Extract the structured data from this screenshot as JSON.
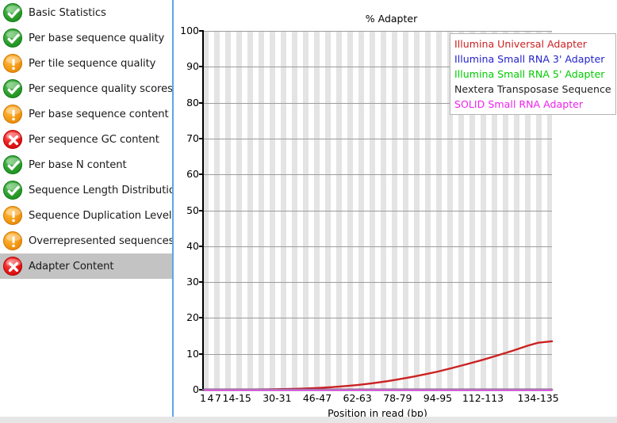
{
  "sidebar": {
    "items": [
      {
        "label": "Basic Statistics",
        "status": "pass",
        "icon": "check-circle-icon",
        "selected": false
      },
      {
        "label": "Per base sequence quality",
        "status": "pass",
        "icon": "check-circle-icon",
        "selected": false
      },
      {
        "label": "Per tile sequence quality",
        "status": "warn",
        "icon": "warning-circle-icon",
        "selected": false
      },
      {
        "label": "Per sequence quality scores",
        "status": "pass",
        "icon": "check-circle-icon",
        "selected": false
      },
      {
        "label": "Per base sequence content",
        "status": "warn",
        "icon": "warning-circle-icon",
        "selected": false
      },
      {
        "label": "Per sequence GC content",
        "status": "fail",
        "icon": "error-circle-icon",
        "selected": false
      },
      {
        "label": "Per base N content",
        "status": "pass",
        "icon": "check-circle-icon",
        "selected": false
      },
      {
        "label": "Sequence Length Distribution",
        "status": "pass",
        "icon": "check-circle-icon",
        "selected": false
      },
      {
        "label": "Sequence Duplication Levels",
        "status": "warn",
        "icon": "warning-circle-icon",
        "selected": false
      },
      {
        "label": "Overrepresented sequences",
        "status": "warn",
        "icon": "warning-circle-icon",
        "selected": false
      },
      {
        "label": "Adapter Content",
        "status": "fail",
        "icon": "error-circle-icon",
        "selected": true
      }
    ]
  },
  "colors": {
    "pass": "#2aa22b",
    "warn": "#f5a01b",
    "fail": "#e01f1f",
    "selected_row": "#c3c3c3",
    "panel_border": "#5ba7e8",
    "grid": "#9c9c9c",
    "stripe": "#e4e4e4"
  },
  "chart_data": {
    "type": "line",
    "title": "% Adapter",
    "xlabel": "Position in read (bp)",
    "ylabel": "",
    "ylim": [
      0,
      100
    ],
    "yticks": [
      0,
      10,
      20,
      30,
      40,
      50,
      60,
      70,
      80,
      90,
      100
    ],
    "grid": true,
    "legend_position": "top-right",
    "xtick_labels": [
      "1",
      "4",
      "7",
      "14-15",
      "30-31",
      "46-47",
      "62-63",
      "78-79",
      "94-95",
      "112-113",
      "134-135"
    ],
    "xtick_positions": [
      1,
      4,
      7,
      14.5,
      30.5,
      46.5,
      62.5,
      78.5,
      94.5,
      112.5,
      134.5
    ],
    "xlim": [
      1,
      140
    ],
    "series": [
      {
        "name": "Illumina Universal Adapter",
        "color": "#cc2222",
        "x": [
          1,
          4,
          7,
          10,
          14.5,
          20.5,
          26.5,
          30.5,
          36.5,
          42.5,
          46.5,
          52.5,
          58.5,
          62.5,
          68.5,
          74.5,
          78.5,
          84.5,
          90.5,
          94.5,
          100.5,
          106.5,
          112.5,
          118.5,
          124.5,
          130.5,
          134.5,
          140
        ],
        "y": [
          0.0,
          0.0,
          0.01,
          0.02,
          0.03,
          0.06,
          0.1,
          0.14,
          0.23,
          0.36,
          0.48,
          0.73,
          1.05,
          1.3,
          1.8,
          2.4,
          2.85,
          3.6,
          4.45,
          5.05,
          6.1,
          7.2,
          8.35,
          9.6,
          10.9,
          12.3,
          13.1,
          13.5
        ]
      },
      {
        "name": "Illumina Small RNA 3' Adapter",
        "color": "#2222cc",
        "x": [
          1,
          140
        ],
        "y": [
          0,
          0
        ]
      },
      {
        "name": "Illumina Small RNA 5' Adapter",
        "color": "#00cc00",
        "x": [
          1,
          140
        ],
        "y": [
          0,
          0
        ]
      },
      {
        "name": "Nextera Transposase Sequence",
        "color": "#222222",
        "x": [
          1,
          140
        ],
        "y": [
          0,
          0
        ]
      },
      {
        "name": "SOLID Small RNA Adapter",
        "color": "#ee22ee",
        "x": [
          1,
          140
        ],
        "y": [
          0,
          0
        ]
      }
    ],
    "legend": [
      {
        "label": "Illumina Universal Adapter",
        "color": "#cc2222"
      },
      {
        "label": "Illumina Small RNA 3' Adapter",
        "color": "#2222cc"
      },
      {
        "label": "Illumina Small RNA 5' Adapter",
        "color": "#00cc00"
      },
      {
        "label": "Nextera Transposase Sequence",
        "color": "#222222"
      },
      {
        "label": "SOLID Small RNA Adapter",
        "color": "#ee22ee"
      }
    ]
  }
}
